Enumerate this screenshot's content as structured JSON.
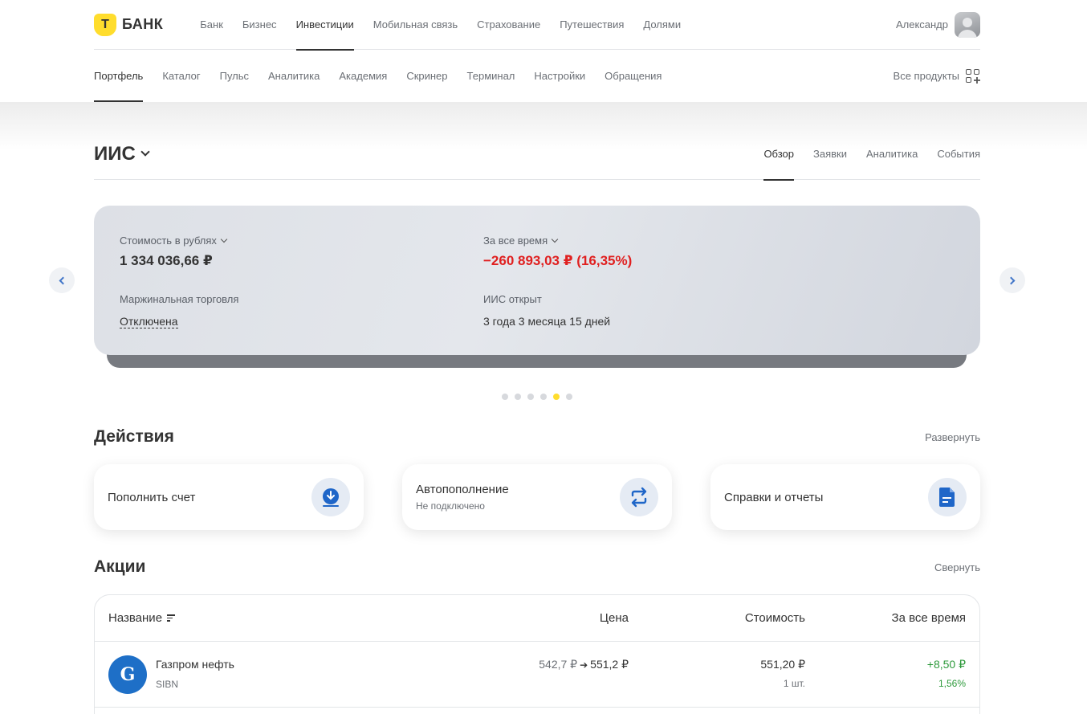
{
  "header": {
    "logo_letter": "Т",
    "logo_text": "БАНК",
    "menu": [
      "Банк",
      "Бизнес",
      "Инвестиции",
      "Мобильная связь",
      "Страхование",
      "Путешествия",
      "Долями"
    ],
    "active_index": 2,
    "user_name": "Александр"
  },
  "subnav": {
    "items": [
      "Портфель",
      "Каталог",
      "Пульс",
      "Аналитика",
      "Академия",
      "Скринер",
      "Терминал",
      "Настройки",
      "Обращения"
    ],
    "active_index": 0,
    "all_products": "Все продукты"
  },
  "account": {
    "title": "ИИС",
    "tabs": [
      "Обзор",
      "Заявки",
      "Аналитика",
      "События"
    ],
    "active_tab": 0
  },
  "summary_card": {
    "value_label": "Стоимость в рублях",
    "value": "1 334 036,66 ₽",
    "period_label": "За все время",
    "period_change": "−260 893,03 ₽ (16,35%)",
    "margin_label": "Маржинальная торговля",
    "margin_value": "Отключена",
    "opened_label": "ИИС открыт",
    "opened_value": "3 года 3 месяца 15 дней",
    "slides_count": 6,
    "active_slide": 4
  },
  "actions": {
    "title": "Действия",
    "expand": "Развернуть",
    "items": [
      {
        "title": "Пополнить счет",
        "subtitle": "",
        "icon": "download-icon"
      },
      {
        "title": "Автопополнение",
        "subtitle": "Не подключено",
        "icon": "refresh-icon"
      },
      {
        "title": "Справки и отчеты",
        "subtitle": "",
        "icon": "document-icon"
      }
    ]
  },
  "stocks": {
    "title": "Акции",
    "collapse": "Свернуть",
    "columns": [
      "Название",
      "Цена",
      "Стоимость",
      "За все время"
    ],
    "rows": [
      {
        "name": "Газпром нефть",
        "ticker": "SIBN",
        "price_from": "542,7 ₽",
        "price_to": "551,2 ₽",
        "value": "551,20 ₽",
        "qty": "1 шт.",
        "change": "+8,50 ₽",
        "change_pct": "1,56%"
      }
    ]
  },
  "colors": {
    "brand_yellow": "#ffdd2d",
    "negative": "#e02020",
    "positive": "#2e9a3c",
    "accent_blue": "#2c6ed5"
  }
}
